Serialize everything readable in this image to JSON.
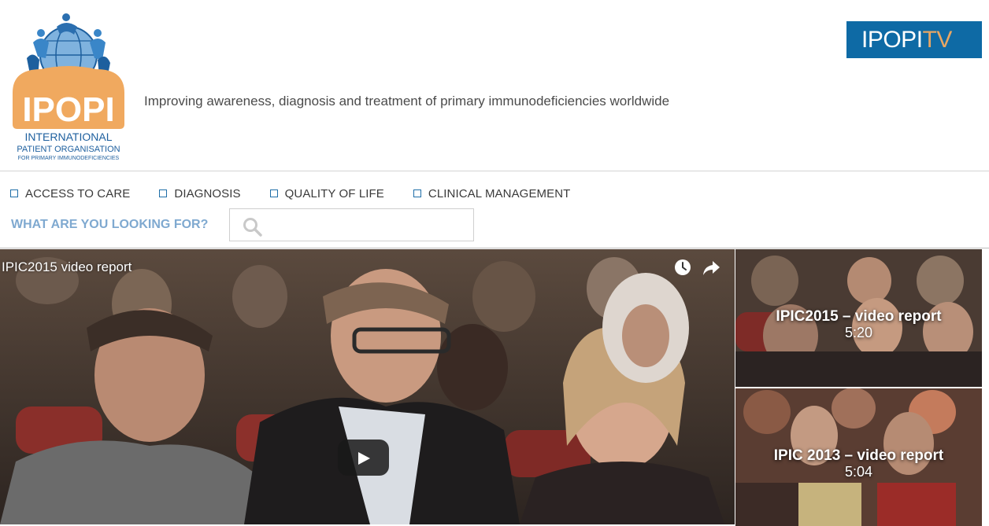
{
  "header": {
    "logo": {
      "wordmark": "IPOPI",
      "line1": "INTERNATIONAL",
      "line2": "PATIENT ORGANISATION",
      "line3": "FOR PRIMARY IMMUNODEFICIENCIES"
    },
    "tagline": "Improving awareness, diagnosis and treatment of primary immunodeficiencies worldwide",
    "tv_logo": {
      "part1": "IPOPI",
      "part2": "TV"
    }
  },
  "nav": {
    "items": [
      {
        "label": "ACCESS TO CARE"
      },
      {
        "label": "DIAGNOSIS"
      },
      {
        "label": "QUALITY OF LIFE"
      },
      {
        "label": "CLINICAL MANAGEMENT"
      }
    ]
  },
  "search": {
    "label": "WHAT ARE YOU LOOKING FOR?",
    "value": "",
    "icon": "search-icon"
  },
  "player": {
    "title": "IPIC2015 video report",
    "icons": [
      "clock-icon",
      "share-icon",
      "play-icon"
    ]
  },
  "playlist": [
    {
      "title": "IPIC2015 – video report",
      "duration": "5:20"
    },
    {
      "title": "IPIC 2013 – video report",
      "duration": "5:04"
    }
  ],
  "colors": {
    "brand_blue": "#0e6aa5",
    "brand_orange": "#e7a664",
    "search_label": "#7fa9d0",
    "nav_box": "#1f6ea8"
  }
}
